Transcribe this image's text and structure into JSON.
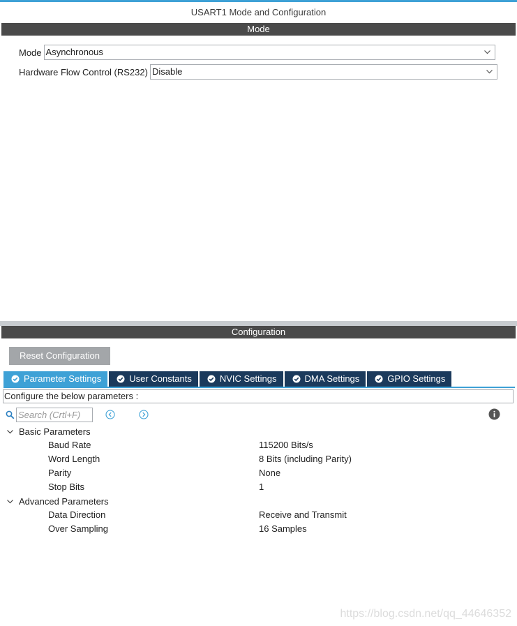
{
  "window": {
    "title": "USART1 Mode and Configuration"
  },
  "mode_section": {
    "header": "Mode",
    "mode": {
      "label": "Mode",
      "value": "Asynchronous"
    },
    "hardware_flow_control": {
      "label": "Hardware Flow Control (RS232)",
      "value": "Disable"
    }
  },
  "config_section": {
    "header": "Configuration",
    "reset_button": "Reset Configuration",
    "tabs": [
      {
        "label": "Parameter Settings",
        "active": true
      },
      {
        "label": "User Constants",
        "active": false
      },
      {
        "label": "NVIC Settings",
        "active": false
      },
      {
        "label": "DMA Settings",
        "active": false
      },
      {
        "label": "GPIO Settings",
        "active": false
      }
    ],
    "hint": "Configure the below parameters :",
    "search": {
      "placeholder": "Search (Crtl+F)"
    },
    "groups": [
      {
        "name": "Basic Parameters",
        "params": [
          {
            "name": "Baud Rate",
            "value": "115200 Bits/s"
          },
          {
            "name": "Word Length",
            "value": "8 Bits (including Parity)"
          },
          {
            "name": "Parity",
            "value": "None"
          },
          {
            "name": "Stop Bits",
            "value": "1"
          }
        ]
      },
      {
        "name": "Advanced Parameters",
        "params": [
          {
            "name": "Data Direction",
            "value": "Receive and Transmit"
          },
          {
            "name": "Over Sampling",
            "value": "16 Samples"
          }
        ]
      }
    ]
  },
  "watermark": "https://blog.csdn.net/qq_44646352",
  "colors": {
    "accent_blue": "#3ea1d6",
    "tab_dark": "#1b3a5c",
    "section_bar": "#4a4a4a",
    "button_gray": "#a3a6a9"
  },
  "icons": [
    "chevron-down-icon",
    "check-circle-icon",
    "search-icon",
    "arrow-left-circle-icon",
    "arrow-right-circle-icon",
    "info-icon",
    "caret-down-icon"
  ]
}
